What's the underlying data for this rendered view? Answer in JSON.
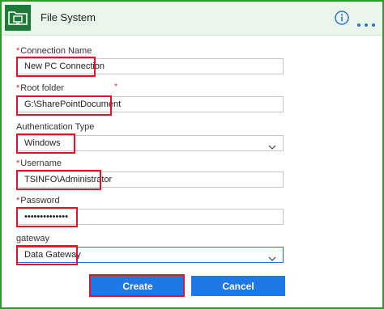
{
  "header": {
    "title": "File System",
    "icons": {
      "app": "folder-computer-icon",
      "info": "info-icon",
      "more": "more-options-icon"
    },
    "background": "#e9f6ea",
    "frame_color": "#2e9a2e"
  },
  "form": {
    "connection_name": {
      "label": "Connection Name",
      "required": "*",
      "value": "New PC Connection"
    },
    "root_folder": {
      "label": "Root folder",
      "required": "*",
      "value": "G:\\SharePointDocument",
      "extra_marker": "*"
    },
    "authentication_type": {
      "label": "Authentication Type",
      "value": "Windows"
    },
    "username": {
      "label": "Username",
      "required": "*",
      "value": "TSINFO\\Administrator"
    },
    "password": {
      "label": "Password",
      "required": "*",
      "value": "••••••••••••••"
    },
    "gateway": {
      "label": "gateway",
      "value": "Data Gateway"
    }
  },
  "buttons": {
    "create": "Create",
    "cancel": "Cancel"
  },
  "colors": {
    "accent": "#1e78e5",
    "highlight": "#e0132a",
    "required": "#d12d2d"
  }
}
